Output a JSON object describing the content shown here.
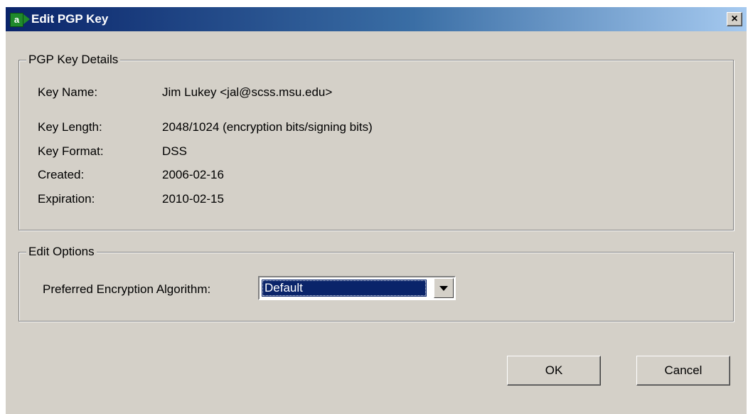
{
  "window": {
    "title": "Edit PGP Key",
    "app_icon_letter": "a",
    "close_label": "×"
  },
  "details": {
    "legend": "PGP Key Details",
    "rows": [
      {
        "label": "Key Name:",
        "value": "Jim Lukey <jal@scss.msu.edu>"
      },
      {
        "label": "Key Length:",
        "value": "2048/1024 (encryption bits/signing bits)"
      },
      {
        "label": "Key Format:",
        "value": "DSS"
      },
      {
        "label": "Created:",
        "value": "2006-02-16"
      },
      {
        "label": "Expiration:",
        "value": "2010-02-15"
      }
    ]
  },
  "edit_options": {
    "legend": "Edit Options",
    "algorithm_label": "Preferred Encryption Algorithm:",
    "algorithm_value": "Default"
  },
  "buttons": {
    "ok": "OK",
    "cancel": "Cancel"
  },
  "colors": {
    "title_start": "#0a246a",
    "title_end": "#a6caf0",
    "dialog_bg": "#d4d0c8",
    "selection_bg": "#0a246a"
  }
}
